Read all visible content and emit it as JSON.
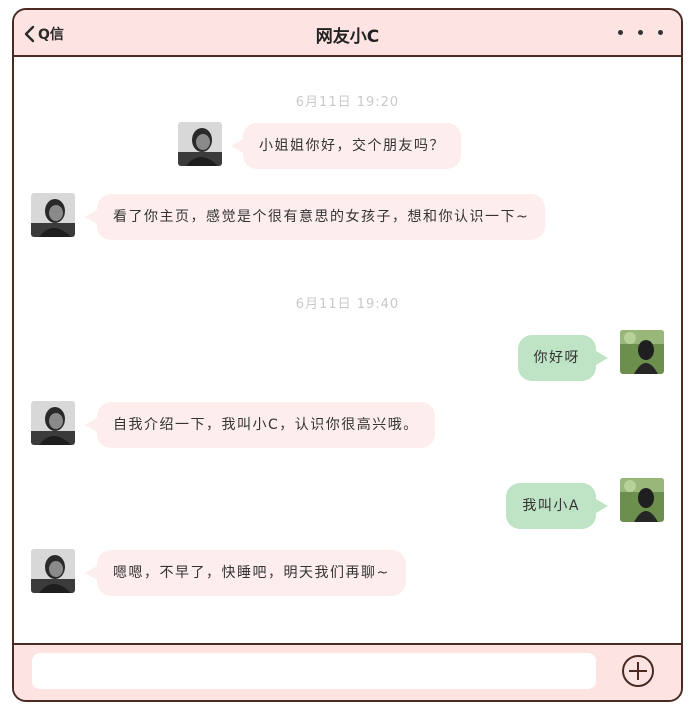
{
  "header": {
    "back_label": "Q信",
    "title": "网友小C"
  },
  "messages": [
    {
      "type": "time",
      "text": "6月11日  19:20"
    },
    {
      "type": "left",
      "text": "小姐姐你好，交个朋友吗？"
    },
    {
      "type": "left",
      "text": "看了你主页，感觉是个很有意思的女孩子，想和你认识一下~"
    },
    {
      "type": "time",
      "text": "6月11日  19:40"
    },
    {
      "type": "right",
      "text": "你好呀"
    },
    {
      "type": "left",
      "text": "自我介绍一下，我叫小C，认识你很高兴哦。"
    },
    {
      "type": "right",
      "text": "我叫小A"
    },
    {
      "type": "left",
      "text": "嗯嗯，不早了，快睡吧，明天我们再聊~"
    }
  ],
  "footer": {
    "input_value": "",
    "input_placeholder": ""
  },
  "colors": {
    "header_bg": "#fde4e3",
    "border": "#4a2a22",
    "left_bubble": "#fdeeed",
    "right_bubble": "#bfe3c5",
    "timestamp": "#c9c9c9"
  },
  "icons": {
    "back": "chevron-left-icon",
    "more": "more-dots-icon",
    "plus": "plus-circle-icon"
  }
}
